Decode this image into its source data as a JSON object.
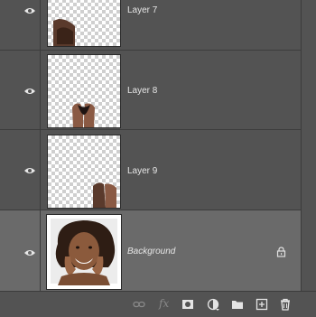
{
  "layers": [
    {
      "name": "Layer 7",
      "selected": false
    },
    {
      "name": "Layer 8",
      "selected": false
    },
    {
      "name": "Layer 9",
      "selected": false
    },
    {
      "name": "Background",
      "selected": true
    }
  ],
  "icons": {
    "visibility": "eye-icon",
    "lock": "lock-icon",
    "link": "link-layers-icon",
    "fx": "fx",
    "mask": "add-mask-icon",
    "adjustment": "adjustment-layer-icon",
    "group": "folder-icon",
    "new_layer": "new-layer-icon",
    "delete": "trash-icon"
  },
  "colors": {
    "panel_bg": "#535353",
    "selected_row": "#6a6a6a",
    "separator": "#3c3c3c",
    "text": "#e6e6e6"
  }
}
